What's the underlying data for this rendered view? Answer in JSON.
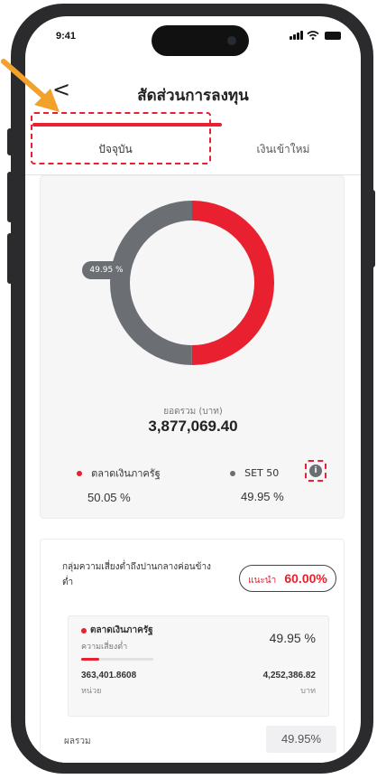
{
  "status_bar": {
    "time": "9:41"
  },
  "header": {
    "back_glyph": "<",
    "title": "สัดส่วนการลงทุน"
  },
  "tabs": [
    {
      "label": "ปัจจุบัน",
      "active": true
    },
    {
      "label": "เงินเข้าใหม่",
      "active": false
    }
  ],
  "allocation": {
    "badge": "49.95 %",
    "total_label": "ยอดรวม (บาท)",
    "total_value": "3,877,069.40",
    "items": [
      {
        "name": "ตลาดเงินภาครัฐ",
        "percent": "50.05 %",
        "value": 50.05,
        "color": "#e8202f"
      },
      {
        "name": "SET 50",
        "percent": "49.95 %",
        "value": 49.95,
        "color": "#6b6f73"
      }
    ]
  },
  "risk": {
    "group_label": "กลุ่มความเสี่ยงต่ำถึงปานกลางค่อนข้างต่ำ",
    "recommend_word": "แนะนำ",
    "recommend_value": "60.00%",
    "fund": {
      "name": "ตลาดเงินภาครัฐ",
      "risk_level": "ความเสี่ยงต่ำ",
      "percent": "49.95 %",
      "risk_bar_fraction": 0.25,
      "units": "363,401.8608",
      "units_label": "หน่วย",
      "amount": "4,252,386.82",
      "amount_label": "บาท"
    },
    "total_label": "ผลรวม",
    "total_value": "49.95%"
  },
  "colors": {
    "accent": "#e8202f",
    "gray": "#6b6f73",
    "callout": "#f2a12b"
  },
  "icons": {
    "back": "chevron-left-icon",
    "info": "info-icon",
    "signal": "signal-icon",
    "wifi": "wifi-icon",
    "battery": "battery-icon"
  }
}
